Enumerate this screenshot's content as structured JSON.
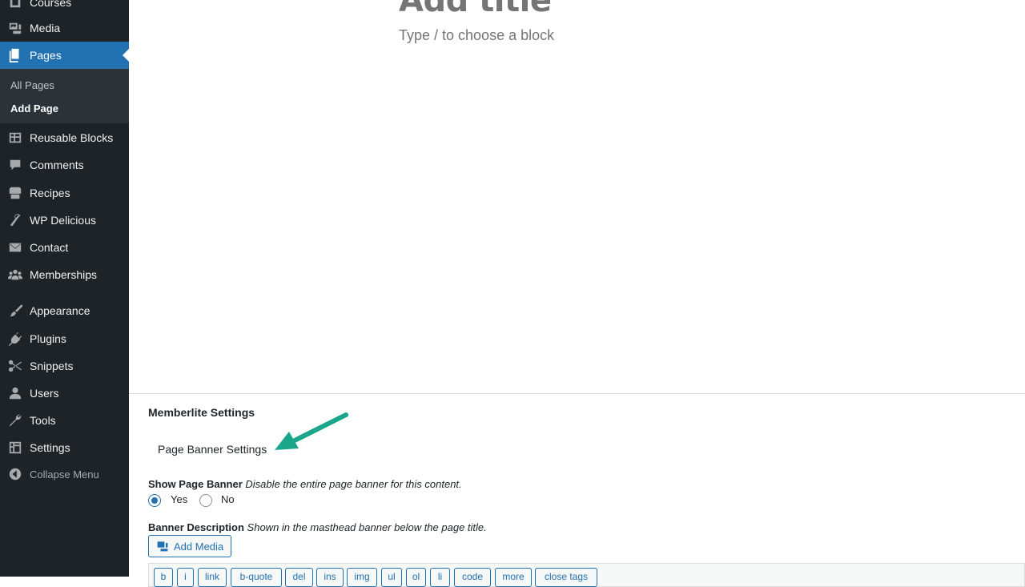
{
  "sidebar": {
    "items": [
      {
        "label": "Courses",
        "icon": "courses-icon"
      },
      {
        "label": "Media",
        "icon": "media-icon"
      },
      {
        "label": "Pages",
        "icon": "pages-icon",
        "active": true
      },
      {
        "label": "Reusable Blocks",
        "icon": "reusable-blocks-icon"
      },
      {
        "label": "Comments",
        "icon": "comments-icon"
      },
      {
        "label": "Recipes",
        "icon": "recipes-icon"
      },
      {
        "label": "WP Delicious",
        "icon": "wp-delicious-icon"
      },
      {
        "label": "Contact",
        "icon": "envelope-icon"
      },
      {
        "label": "Memberships",
        "icon": "groups-icon"
      },
      {
        "label": "Appearance",
        "icon": "paintbrush-icon"
      },
      {
        "label": "Plugins",
        "icon": "plugin-icon"
      },
      {
        "label": "Snippets",
        "icon": "scissors-icon"
      },
      {
        "label": "Users",
        "icon": "user-icon"
      },
      {
        "label": "Tools",
        "icon": "wrench-icon"
      },
      {
        "label": "Settings",
        "icon": "settings-icon"
      }
    ],
    "submenu": [
      {
        "label": "All Pages"
      },
      {
        "label": "Add Page",
        "current": true
      }
    ],
    "collapse_label": "Collapse Menu"
  },
  "editor": {
    "title_placeholder": "Add title",
    "block_hint": "Type / to choose a block"
  },
  "metabox": {
    "title": "Memberlite Settings",
    "section_heading": "Page Banner Settings",
    "show_banner": {
      "label": "Show Page Banner",
      "description": "Disable the entire page banner for this content.",
      "options": [
        {
          "label": "Yes",
          "checked": true
        },
        {
          "label": "No",
          "checked": false
        }
      ]
    },
    "banner_description": {
      "label": "Banner Description",
      "description": "Shown in the masthead banner below the page title."
    },
    "add_media_label": "Add Media",
    "quicktags": [
      "b",
      "i",
      "link",
      "b-quote",
      "del",
      "ins",
      "img",
      "ul",
      "ol",
      "li",
      "code",
      "more",
      "close tags"
    ]
  },
  "colors": {
    "sidebar_bg": "#1d2327",
    "submenu_bg": "#2c3338",
    "accent": "#2271b1",
    "annotation_arrow": "#1aa68a"
  }
}
